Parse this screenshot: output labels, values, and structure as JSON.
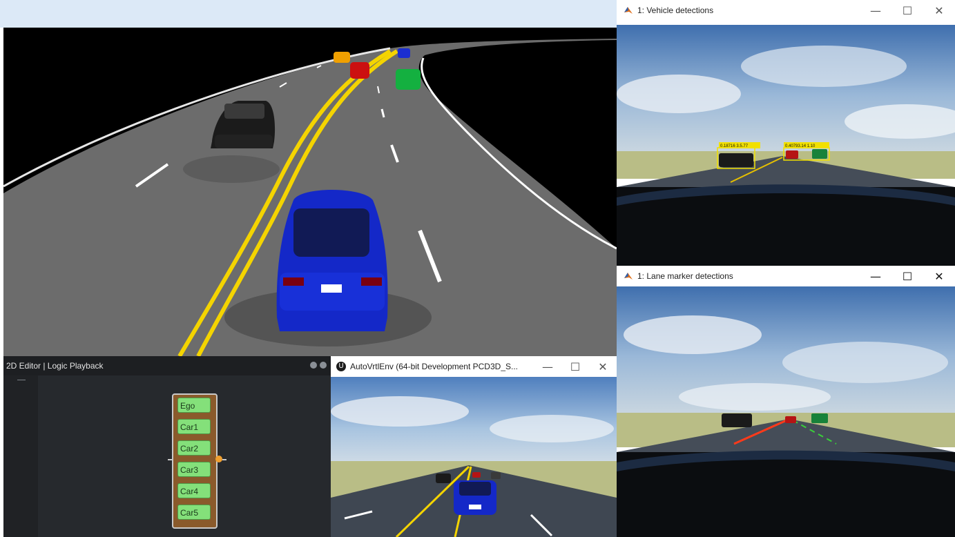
{
  "top_strip_color": "#dce9f7",
  "main_view": {
    "road_color": "#6c6c6c",
    "lane_marking_color": "#ffffff",
    "center_line_color": "#f4d400",
    "ego_car_color": "#1428c8"
  },
  "vehicle_window": {
    "title": "1: Vehicle detections",
    "icon": "matlab-icon",
    "controls": {
      "minimize": "—",
      "maximize": "☐",
      "close": "✕"
    },
    "detection_labels": [
      "0.18716 3.5.77",
      "0.40793.14 1.10"
    ]
  },
  "lane_window": {
    "title": "1: Lane marker detections",
    "icon": "matlab-icon",
    "controls": {
      "minimize": "—",
      "maximize": "☐",
      "close": "✕"
    }
  },
  "editor": {
    "title": "2D Editor | Logic Playback",
    "actors": [
      "Ego",
      "Car1",
      "Car2",
      "Car3",
      "Car4",
      "Car5"
    ]
  },
  "unreal_window": {
    "title": "AutoVrtlEnv (64-bit Development PCD3D_S...",
    "icon": "unreal-engine-icon",
    "controls": {
      "minimize": "—",
      "maximize": "☐",
      "close": "✕"
    }
  }
}
